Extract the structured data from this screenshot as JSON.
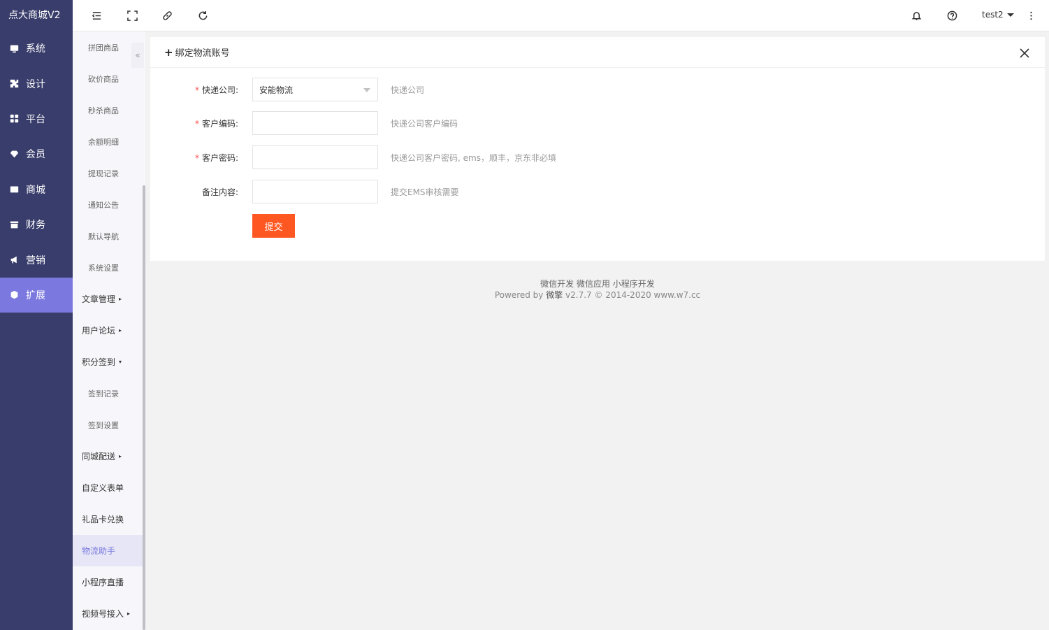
{
  "app": {
    "title": "点大商城V2"
  },
  "sidebar": {
    "items": [
      {
        "label": "系统",
        "icon": "monitor-icon"
      },
      {
        "label": "设计",
        "icon": "puzzle-icon"
      },
      {
        "label": "平台",
        "icon": "grid-icon"
      },
      {
        "label": "会员",
        "icon": "diamond-icon"
      },
      {
        "label": "商城",
        "icon": "mail-icon"
      },
      {
        "label": "财务",
        "icon": "archive-icon"
      },
      {
        "label": "营销",
        "icon": "megaphone-icon"
      },
      {
        "label": "扩展",
        "icon": "cube-icon",
        "active": true
      }
    ]
  },
  "subnav": {
    "collapse": "«",
    "items": [
      {
        "label": "拼团商品",
        "type": "sub"
      },
      {
        "label": "砍价商品",
        "type": "sub"
      },
      {
        "label": "秒杀商品",
        "type": "sub"
      },
      {
        "label": "余额明细",
        "type": "sub"
      },
      {
        "label": "提现记录",
        "type": "sub"
      },
      {
        "label": "通知公告",
        "type": "sub"
      },
      {
        "label": "默认导航",
        "type": "sub"
      },
      {
        "label": "系统设置",
        "type": "sub"
      },
      {
        "label": "文章管理",
        "type": "grp",
        "caret": "▸"
      },
      {
        "label": "用户论坛",
        "type": "grp",
        "caret": "▸"
      },
      {
        "label": "积分签到",
        "type": "grp",
        "caret": "▾"
      },
      {
        "label": "签到记录",
        "type": "sub"
      },
      {
        "label": "签到设置",
        "type": "sub"
      },
      {
        "label": "同城配送",
        "type": "grp",
        "caret": "▸"
      },
      {
        "label": "自定义表单",
        "type": "grp"
      },
      {
        "label": "礼品卡兑换",
        "type": "grp"
      },
      {
        "label": "物流助手",
        "type": "grp",
        "current": true
      },
      {
        "label": "小程序直播",
        "type": "grp"
      },
      {
        "label": "视频号接入",
        "type": "grp",
        "caret": "▸"
      }
    ]
  },
  "header": {
    "icons": [
      "menu-fold-icon",
      "fullscreen-icon",
      "link-icon",
      "refresh-icon",
      "bell-icon",
      "help-icon",
      "more-icon"
    ],
    "user": "test2"
  },
  "panel": {
    "title": "绑定物流账号",
    "fields": [
      {
        "label": "快递公司:",
        "required": true,
        "type": "select",
        "value": "安能物流",
        "tip": "快递公司"
      },
      {
        "label": "客户编码:",
        "required": true,
        "type": "input",
        "value": "",
        "tip": "快递公司客户编码"
      },
      {
        "label": "客户密码:",
        "required": true,
        "type": "input",
        "value": "",
        "tip": "快递公司客户密码, ems，顺丰，京东非必填"
      },
      {
        "label": "备注内容:",
        "required": false,
        "type": "input",
        "value": "",
        "tip": "提交EMS审核需要"
      }
    ],
    "submit": "提交"
  },
  "footer": {
    "links": "微信开发 微信应用 小程序开发",
    "powered_prefix": "Powered by ",
    "powered_brand": "微擎",
    "powered_suffix": " v2.7.7 © 2014-2020 www.w7.cc"
  },
  "colors": {
    "sidebar": "#393d6b",
    "active": "#7b79df",
    "submit": "#ff5722",
    "required": "#ff4d4f"
  }
}
